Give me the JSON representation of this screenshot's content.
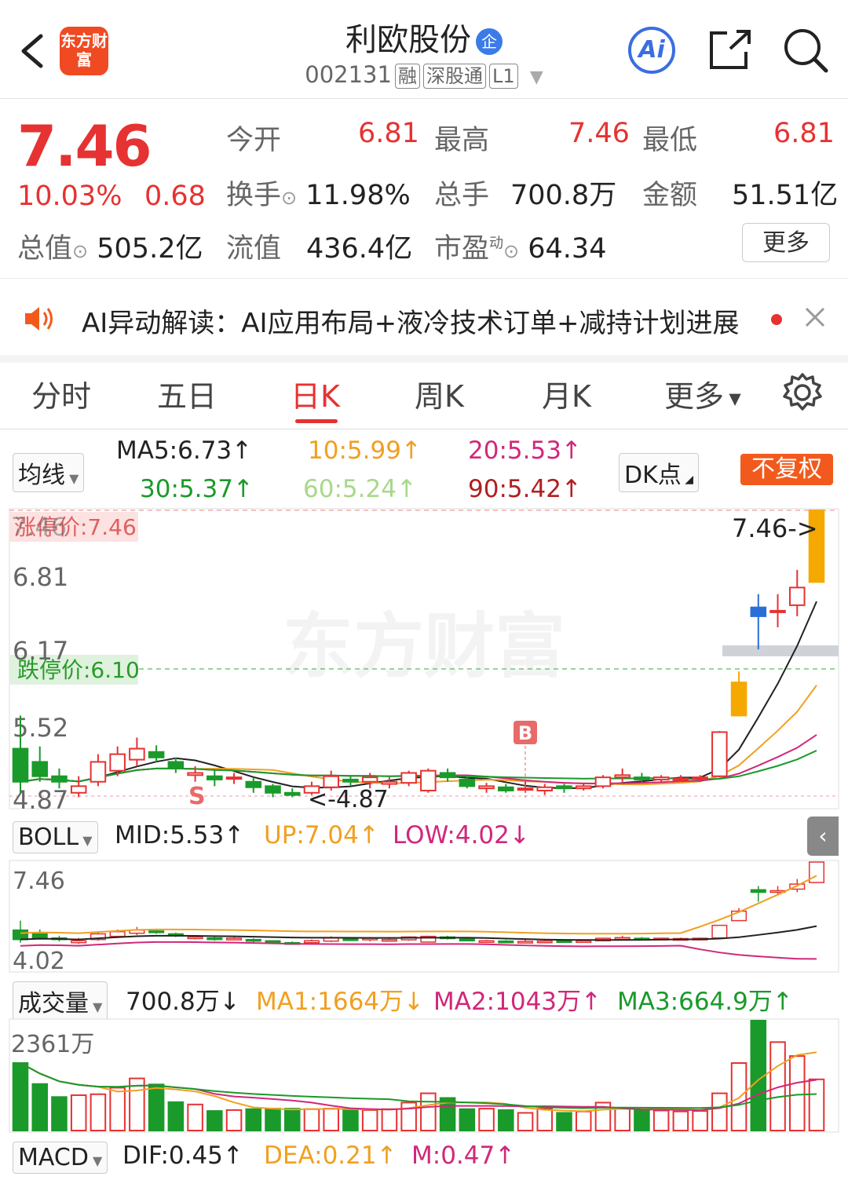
{
  "header": {
    "title": "利欧股份",
    "qi_badge": "企",
    "code": "002131",
    "tags": [
      "融",
      "深股通",
      "L1"
    ],
    "logo": "东方财富",
    "ai_label": "Ai"
  },
  "quote": {
    "price": "7.46",
    "change_pct": "10.03%",
    "change": "0.68",
    "open_label": "今开",
    "open": "6.81",
    "high_label": "最高",
    "high": "7.46",
    "low_label": "最低",
    "low": "6.81",
    "turnover_label": "换手",
    "turnover": "11.98%",
    "volume_label": "总手",
    "volume": "700.8万",
    "amount_label": "金额",
    "amount": "51.51亿",
    "mktcap_label": "总值",
    "mktcap": "505.2亿",
    "float_label": "流值",
    "float": "436.4亿",
    "pe_label": "市盈",
    "pe_sup": "动",
    "pe": "64.34",
    "more": "更多"
  },
  "news": {
    "text": "AI异动解读：AI应用布局+液冷技术订单+减持计划进展"
  },
  "tabs": [
    "分时",
    "五日",
    "日K",
    "周K",
    "月K",
    "更多"
  ],
  "active_tab": "日K",
  "ma_row": {
    "selector": "均线",
    "ma5": "MA5:6.73↑",
    "ma10": "10:5.99↑",
    "ma20": "20:5.53↑",
    "ma30": "30:5.37↑",
    "ma60": "60:5.24↑",
    "ma90": "90:5.42↑",
    "dk": "DK点",
    "fq": "不复权"
  },
  "kline": {
    "limit_up": "涨停价:7.46",
    "limit_down": "跌停价:6.10",
    "axis": [
      "7.46",
      "6.81",
      "6.17",
      "5.52",
      "4.87"
    ],
    "last_label": "7.46->",
    "low_label": "<-4.87",
    "watermark": "东方财富",
    "marker_b": "B",
    "marker_s": "S"
  },
  "boll": {
    "selector": "BOLL",
    "mid": "MID:5.53↑",
    "up": "UP:7.04↑",
    "low": "LOW:4.02↓",
    "axis_top": "7.46",
    "axis_bottom": "4.02"
  },
  "volume": {
    "selector": "成交量",
    "vol": "700.8万↓",
    "ma1": "MA1:1664万↓",
    "ma2": "MA2:1043万↑",
    "ma3": "MA3:664.9万↑",
    "axis_top": "2361万"
  },
  "macd": {
    "selector": "MACD",
    "dif": "DIF:0.45↑",
    "dea": "DEA:0.21↑",
    "m": "M:0.47↑"
  },
  "colors": {
    "up": "#e63232",
    "down": "#1a9a2a",
    "accent": "#f25a1d",
    "blue": "#3a6ee0"
  },
  "chart_data": {
    "type": "candlestick",
    "ohlc": [
      [
        5.3,
        5.6,
        4.9,
        5.0
      ],
      [
        5.18,
        5.32,
        5.0,
        5.05
      ],
      [
        5.05,
        5.12,
        4.94,
        5.0
      ],
      [
        4.9,
        5.05,
        4.86,
        4.96
      ],
      [
        5.0,
        5.25,
        4.96,
        5.18
      ],
      [
        5.1,
        5.32,
        5.05,
        5.25
      ],
      [
        5.2,
        5.4,
        5.14,
        5.3
      ],
      [
        5.27,
        5.33,
        5.18,
        5.22
      ],
      [
        5.18,
        5.22,
        5.08,
        5.12
      ],
      [
        5.06,
        5.14,
        5.0,
        5.08
      ],
      [
        5.05,
        5.1,
        4.96,
        5.02
      ],
      [
        5.04,
        5.08,
        4.98,
        5.04
      ],
      [
        5.0,
        5.04,
        4.9,
        4.95
      ],
      [
        4.96,
        4.98,
        4.86,
        4.9
      ],
      [
        4.9,
        4.94,
        4.86,
        4.88
      ],
      [
        4.9,
        5.0,
        4.88,
        4.96
      ],
      [
        4.95,
        5.1,
        4.92,
        5.05
      ],
      [
        5.02,
        5.06,
        4.96,
        5.0
      ],
      [
        5.0,
        5.08,
        4.94,
        5.04
      ],
      [
        4.98,
        5.04,
        4.94,
        5.0
      ],
      [
        4.99,
        5.1,
        4.96,
        5.08
      ],
      [
        4.92,
        5.12,
        4.9,
        5.1
      ],
      [
        5.08,
        5.12,
        5.0,
        5.04
      ],
      [
        5.02,
        5.04,
        4.94,
        4.96
      ],
      [
        4.94,
        4.99,
        4.9,
        4.96
      ],
      [
        4.95,
        4.98,
        4.9,
        4.92
      ],
      [
        4.93,
        5.01,
        4.9,
        4.94
      ],
      [
        4.92,
        4.98,
        4.88,
        4.95
      ],
      [
        4.96,
        4.98,
        4.9,
        4.94
      ],
      [
        4.94,
        4.98,
        4.92,
        4.96
      ],
      [
        4.96,
        5.06,
        4.94,
        5.04
      ],
      [
        5.04,
        5.12,
        5.0,
        5.06
      ],
      [
        5.04,
        5.08,
        5.0,
        5.02
      ],
      [
        5.02,
        5.06,
        5.0,
        5.04
      ],
      [
        5.03,
        5.06,
        5.0,
        5.03
      ],
      [
        5.03,
        5.06,
        5.0,
        5.04
      ],
      [
        5.05,
        5.46,
        5.04,
        5.45
      ],
      [
        5.6,
        6.0,
        5.6,
        5.9
      ],
      [
        6.58,
        6.7,
        6.2,
        6.5
      ],
      [
        6.55,
        6.7,
        6.4,
        6.55
      ],
      [
        6.6,
        6.92,
        6.5,
        6.76
      ],
      [
        6.81,
        7.46,
        6.81,
        7.46
      ]
    ],
    "ylim": [
      4.87,
      7.46
    ],
    "volume": [
      1450,
      1000,
      720,
      760,
      780,
      920,
      1120,
      990,
      610,
      560,
      420,
      440,
      460,
      470,
      470,
      460,
      470,
      430,
      440,
      460,
      600,
      800,
      700,
      460,
      470,
      440,
      380,
      470,
      380,
      410,
      600,
      480,
      430,
      430,
      410,
      420,
      800,
      1450,
      2361,
      1900,
      1600,
      1100
    ]
  }
}
